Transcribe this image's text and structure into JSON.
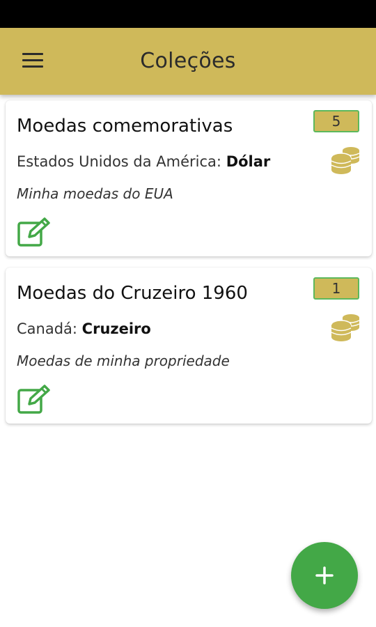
{
  "app_bar": {
    "title": "Coleções",
    "menu_icon": "menu-icon",
    "color": "#cfb95a"
  },
  "collections": [
    {
      "name": "Moedas comemorativas",
      "country": "Estados Unidos da América:",
      "currency": "Dólar",
      "description": "Minha moedas do EUA",
      "count": "5"
    },
    {
      "name": "Moedas do Cruzeiro 1960",
      "country": "Canadá:",
      "currency": "Cruzeiro",
      "description": "Moedas de minha propriedade",
      "count": "1"
    }
  ],
  "icons": {
    "edit": "edit-icon",
    "coins": "coins-icon",
    "add": "add-icon"
  },
  "colors": {
    "accent": "#cfb95a",
    "green": "#43a847"
  }
}
